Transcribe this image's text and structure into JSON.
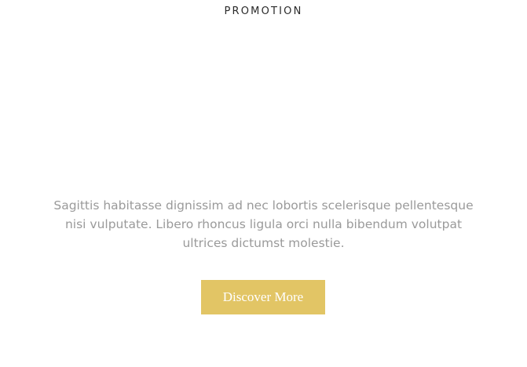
{
  "section": {
    "eyebrow": "PROMOTION",
    "description": "Sagittis habitasse dignissim ad nec lobortis scelerisque pellentesque nisi vulputate. Libero rhoncus ligula orci nulla bibendum volutpat ultrices dictumst molestie.",
    "cta_label": "Discover More"
  },
  "colors": {
    "accent": "#e2c565",
    "body_text": "#9a9a9a",
    "heading": "#2a2a2a"
  }
}
